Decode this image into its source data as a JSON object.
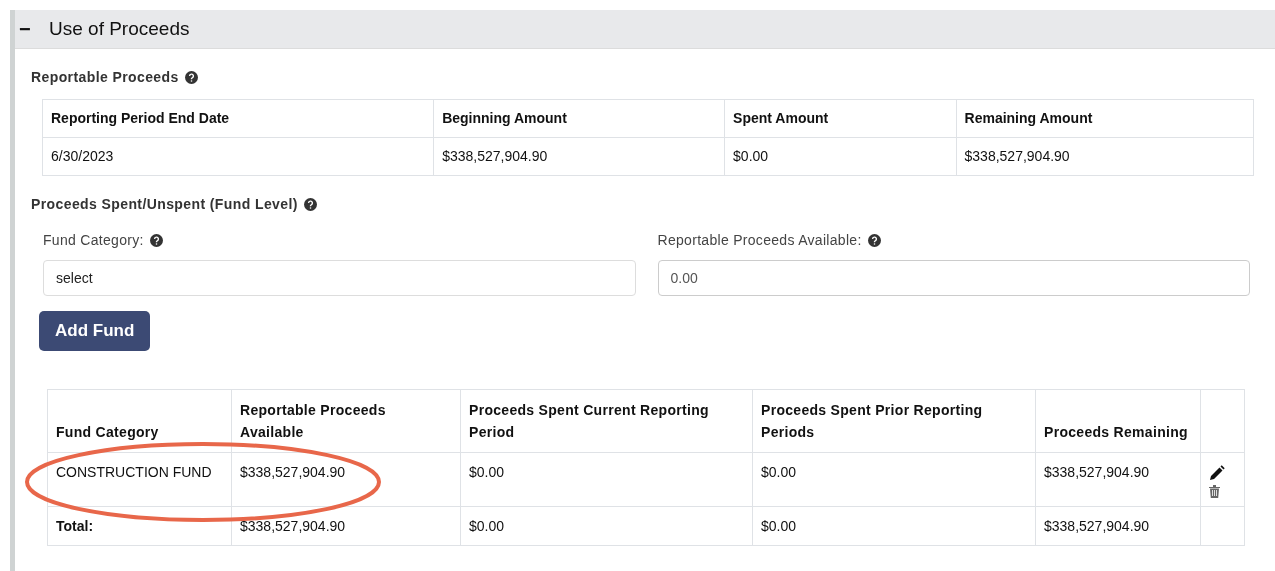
{
  "section": {
    "toggle": "−",
    "title": "Use of Proceeds",
    "expanded": true
  },
  "reportable": {
    "title": "Reportable Proceeds",
    "columns": [
      "Reporting Period End Date",
      "Beginning Amount",
      "Spent Amount",
      "Remaining Amount"
    ],
    "rows": [
      [
        "6/30/2023",
        "$338,527,904.90",
        "$0.00",
        "$338,527,904.90"
      ]
    ]
  },
  "fund_level": {
    "title": "Proceeds Spent/Unspent (Fund Level)",
    "fund_category": {
      "label": "Fund Category:",
      "value": "select"
    },
    "available": {
      "label": "Reportable Proceeds Available:",
      "value": "0.00"
    },
    "add_button": "Add Fund",
    "table": {
      "columns": [
        "Fund Category",
        "Reportable Proceeds Available",
        "Proceeds Spent Current Reporting Period",
        "Proceeds Spent Prior Reporting Periods",
        "Proceeds Remaining"
      ],
      "rows": [
        {
          "cells": [
            "CONSTRUCTION FUND",
            "$338,527,904.90",
            "$0.00",
            "$0.00",
            "$338,527,904.90"
          ],
          "highlighted": true
        }
      ],
      "total": [
        "Total:",
        "$338,527,904.90",
        "$0.00",
        "$0.00",
        "$338,527,904.90"
      ]
    }
  }
}
